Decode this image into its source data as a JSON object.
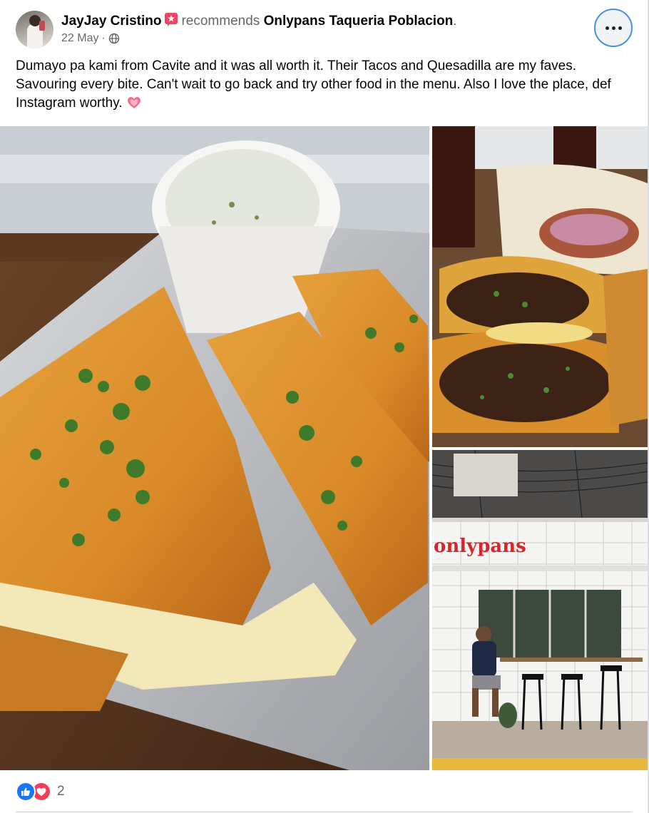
{
  "post": {
    "author": "JayJay Cristino",
    "action": "recommends",
    "page_name": "Onlypans Taqueria Poblacion",
    "period": ".",
    "date": "22 May",
    "separator": "·",
    "privacy_icon": "globe-icon",
    "more_icon": "more-options-icon",
    "caption": "Dumayo pa kami from Cavite and it was all worth it. Their Tacos and Quesadilla are my faves. Savouring every bite. Can't wait to go back and try other food in the menu. Also I love the place, def Instagram worthy.",
    "caption_emoji": "heart-emoji"
  },
  "photos": {
    "store_sign": "onlypans"
  },
  "reactions": {
    "types": [
      "like-icon",
      "love-icon"
    ],
    "count": "2"
  },
  "colors": {
    "like": "#1877f2",
    "love": "#f33e58",
    "recommend_badge": "#f3425f",
    "sign_red": "#d7262b"
  }
}
